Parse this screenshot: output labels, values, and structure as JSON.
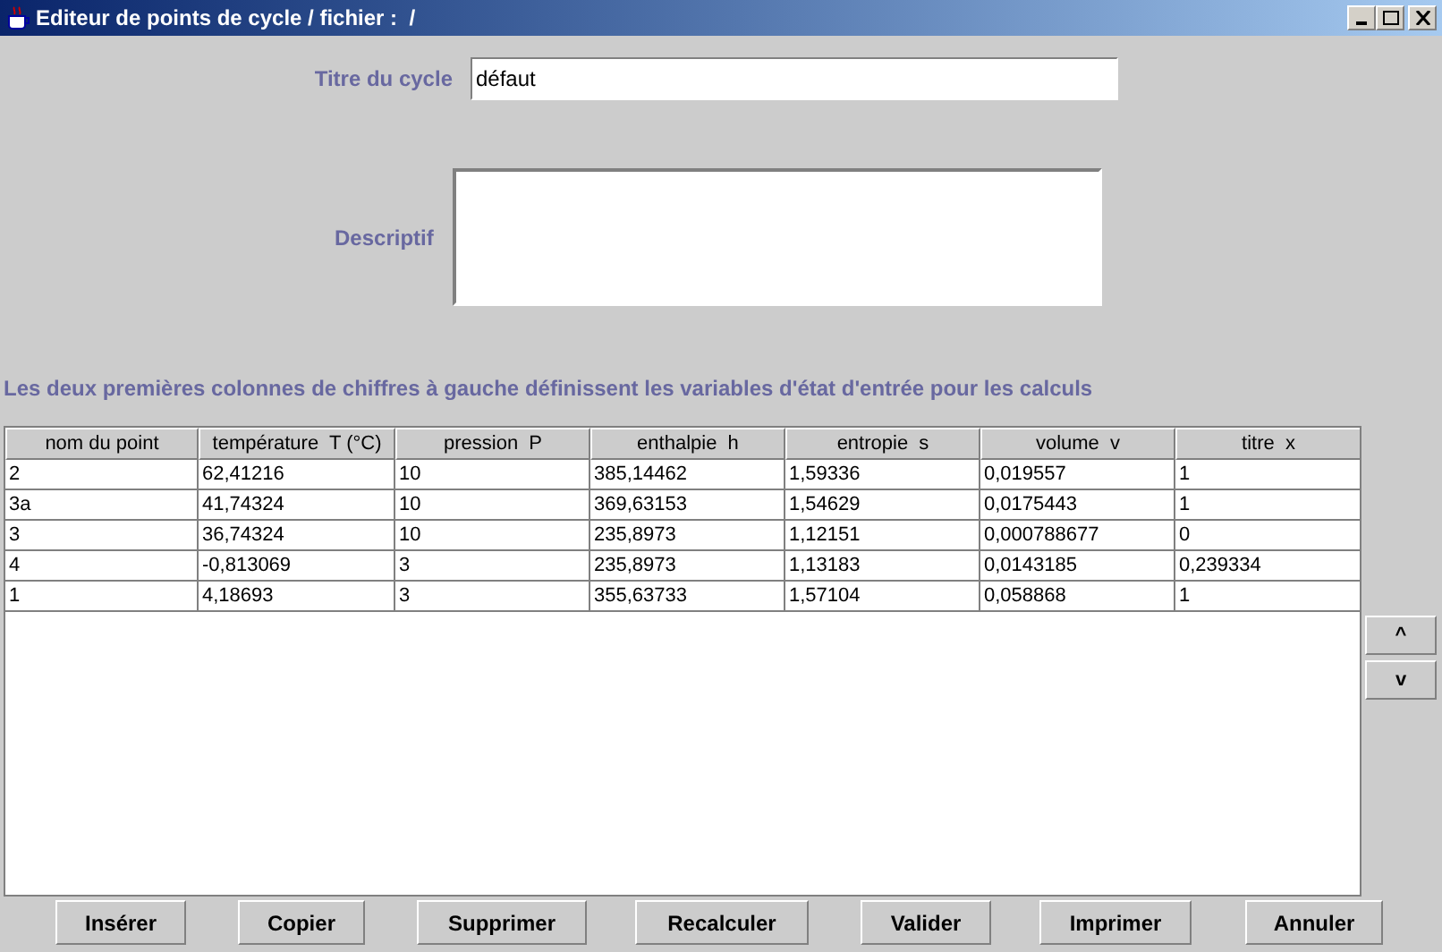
{
  "window": {
    "title": "Editeur de points de cycle / fichier :  /"
  },
  "form": {
    "title_label": "Titre du cycle",
    "title_value": "défaut",
    "description_label": "Descriptif"
  },
  "hint": "Les deux premières colonnes de chiffres à gauche définissent les variables d'état d'entrée pour les calculs",
  "table": {
    "columns": [
      "nom du point",
      "température  T (°C)",
      "pression  P",
      "enthalpie  h",
      "entropie  s",
      "volume  v",
      "titre  x"
    ],
    "rows": [
      [
        "2",
        "62,41216",
        "10",
        "385,14462",
        "1,59336",
        "0,019557",
        "1"
      ],
      [
        "3a",
        "41,74324",
        "10",
        "369,63153",
        "1,54629",
        "0,0175443",
        "1"
      ],
      [
        "3",
        "36,74324",
        "10",
        "235,8973",
        "1,12151",
        "0,000788677",
        "0"
      ],
      [
        "4",
        "-0,813069",
        "3",
        "235,8973",
        "1,13183",
        "0,0143185",
        "0,239334"
      ],
      [
        "1",
        "4,18693",
        "3",
        "355,63733",
        "1,57104",
        "0,058868",
        "1"
      ]
    ]
  },
  "move_buttons": [
    "^",
    "v"
  ],
  "buttons": [
    "Insérer",
    "Copier",
    "Supprimer",
    "Recalculer",
    "Valider",
    "Imprimer",
    "Annuler"
  ]
}
